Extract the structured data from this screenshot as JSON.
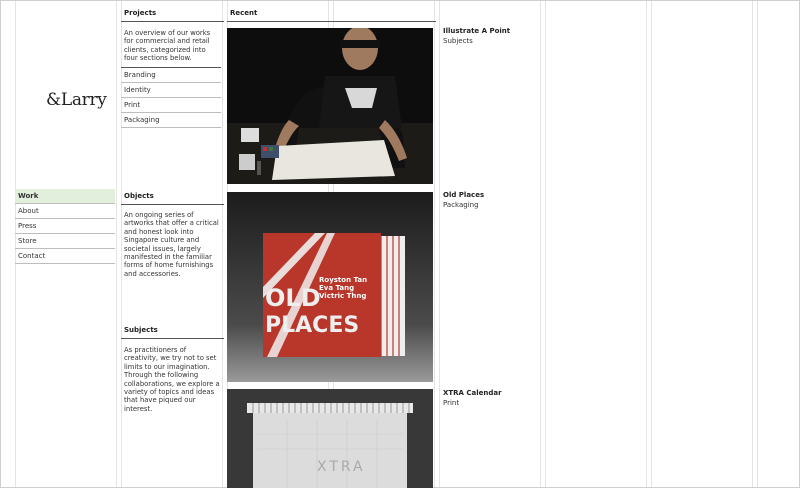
{
  "brand": {
    "logo_text": "&Larry"
  },
  "nav": {
    "items": [
      {
        "label": "Work",
        "active": true
      },
      {
        "label": "About"
      },
      {
        "label": "Press"
      },
      {
        "label": "Store"
      },
      {
        "label": "Contact"
      }
    ]
  },
  "projects": {
    "heading": "Projects",
    "description": "An overview of our works for commercial and retail clients, categorized into four sections below.",
    "categories": [
      "Branding",
      "Identity",
      "Print",
      "Packaging"
    ]
  },
  "objects": {
    "heading": "Objects",
    "description": "An ongoing series of artworks that offer a critical and honest look into Singapore culture and societal issues, largely manifested in the familiar forms of home furnishings and accessories."
  },
  "subjects": {
    "heading": "Subjects",
    "description": "As practitioners of creativity, we try not to set limits to our imagination. Through the following collaborations, we explore a variety of topics and ideas that have piqued our interest."
  },
  "recent": {
    "heading": "Recent",
    "works": [
      {
        "title": "Illustrate A Point",
        "category": "Subjects"
      },
      {
        "title": "Old Places",
        "category": "Packaging",
        "cover_text": {
          "line1": "OLD",
          "line2": "PLACES",
          "credits": [
            "Royston Tan",
            "Eva Tang",
            "Victric Thng"
          ]
        }
      },
      {
        "title": "XTRA Calendar",
        "category": "Print",
        "cover_text": "XTRA"
      }
    ]
  },
  "colors": {
    "active_nav_bg": "#e2efdc",
    "old_places_red": "#b8362a"
  }
}
